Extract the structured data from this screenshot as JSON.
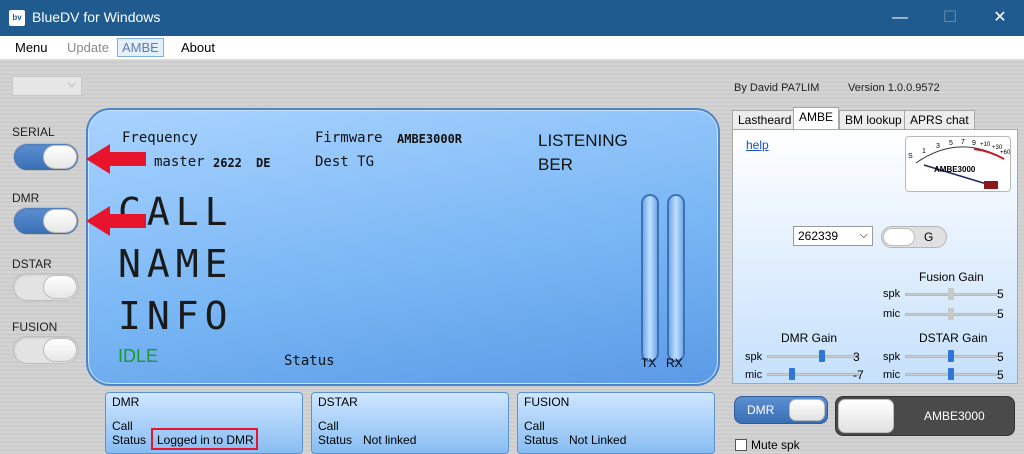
{
  "window": {
    "title": "BlueDV for Windows",
    "icon_text": "bv",
    "minimize": "—",
    "maximize": "☐",
    "close": "✕"
  },
  "menu": {
    "items": [
      "Menu",
      "Update",
      "AMBE",
      "About"
    ]
  },
  "sidebar": {
    "combo_chevron": "⌵",
    "serial": "SERIAL",
    "dmr": "DMR",
    "dstar": "DSTAR",
    "fusion": "FUSION"
  },
  "lcd": {
    "frequency": "Frequency",
    "master_label": "master",
    "master_value": "2622",
    "master_suffix": "DE",
    "firmware_label": "Firmware",
    "firmware_value": "AMBE3000R",
    "dest_tg": "Dest TG",
    "listening": "LISTENING",
    "ber": "BER",
    "call": "CALL",
    "name": "NAME",
    "info": "INFO",
    "idle": "IDLE",
    "status": "Status",
    "tx": "TX",
    "rx": "RX"
  },
  "modes": [
    {
      "title": "DMR",
      "call_label": "Call",
      "status_label": "Status",
      "status_value": "Logged in to DMR"
    },
    {
      "title": "DSTAR",
      "call_label": "Call",
      "status_label": "Status",
      "status_value": "Not linked"
    },
    {
      "title": "FUSION",
      "call_label": "Call",
      "status_label": "Status",
      "status_value": "Not Linked"
    }
  ],
  "header_right": {
    "author": "By David PA7LIM",
    "version": "Version 1.0.0.9572"
  },
  "tabs": [
    "Lastheard",
    "AMBE",
    "BM lookup",
    "APRS chat"
  ],
  "ambe": {
    "help": "help",
    "meter_label": "AMBE3000",
    "meter_scale": [
      "S",
      "1",
      "3",
      "5",
      "7",
      "9",
      "+10",
      "+30",
      "+60"
    ],
    "combo_value": "262339",
    "combo_chevron": "⌵",
    "g_button": "G",
    "fusion_gain": {
      "title": "Fusion Gain",
      "spk_label": "spk",
      "spk_value": "5",
      "spk_level": 0.5,
      "mic_label": "mic",
      "mic_value": "5",
      "mic_level": 0.5
    },
    "dmr_gain": {
      "title": "DMR Gain",
      "spk_label": "spk",
      "spk_value": "3",
      "spk_level": 0.6,
      "mic_label": "mic",
      "mic_value": "-7",
      "mic_level": 0.25
    },
    "dstar_gain": {
      "title": "DSTAR Gain",
      "spk_label": "spk",
      "spk_value": "5",
      "spk_level": 0.5,
      "mic_label": "mic",
      "mic_value": "5",
      "mic_level": 0.5
    }
  },
  "bottom_right": {
    "dmr_toggle": "DMR",
    "ambe_button": "AMBE3000",
    "mute_spk": "Mute spk"
  },
  "colors": {
    "title_bar": "#1f5b8f",
    "lcd": "#7ab7f5",
    "idle": "#1a9a2a",
    "highlight": "#e8142c",
    "arrow": "#e8142c",
    "link": "#1a4fd8"
  }
}
